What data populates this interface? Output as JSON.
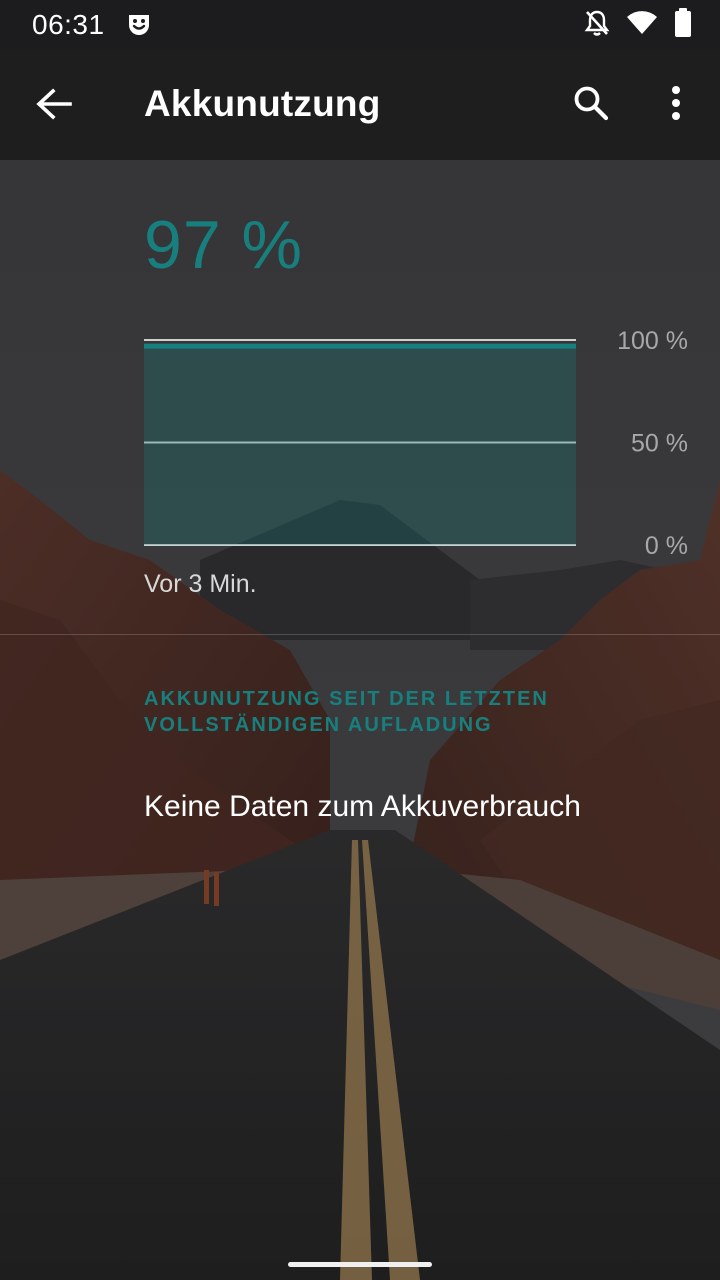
{
  "status_bar": {
    "time": "06:31",
    "app_icon": "smiley-notification-icon",
    "icons": [
      "notifications-off-icon",
      "wifi-icon",
      "battery-full-icon"
    ]
  },
  "app_bar": {
    "title": "Akkunutzung",
    "back_icon": "arrow-back-icon",
    "search_icon": "search-icon",
    "more_icon": "more-vert-icon"
  },
  "battery": {
    "level_text": "97 %"
  },
  "chart_data": {
    "type": "area",
    "y_tick_labels": [
      "100 %",
      "50 %",
      "0 %"
    ],
    "ylim": [
      0,
      100
    ],
    "values": [
      97,
      97
    ],
    "x_label": "Vor 3 Min.",
    "grid": true,
    "fill_color": "#17807f"
  },
  "section": {
    "header": "AKKUNUTZUNG SEIT DER LETZTEN VOLLSTÄNDIGEN AUFLADUNG",
    "message": "Keine Daten zum Akkuverbrauch"
  },
  "colors": {
    "accent": "#17807f",
    "app_bar": "#1e1e1e",
    "status_bar": "#1c1c1e"
  }
}
